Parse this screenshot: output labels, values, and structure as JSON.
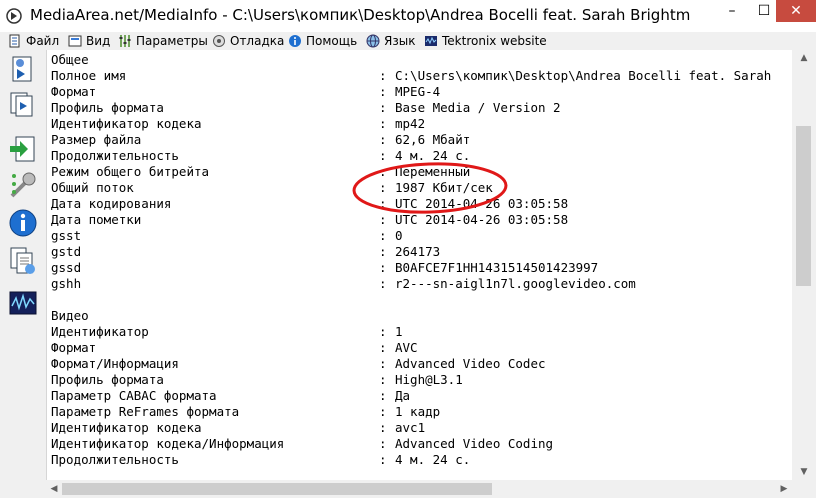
{
  "window": {
    "title": "MediaArea.net/MediaInfo - C:\\Users\\компик\\Desktop\\Andrea Bocelli feat. Sarah Brightman Canto de",
    "minimize": "–",
    "maximize": "☐",
    "close": "✕"
  },
  "menu": {
    "file": "Файл",
    "view": "Вид",
    "options": "Параметры",
    "debug": "Отладка",
    "help": "Помощь",
    "language": "Язык",
    "tektronix": "Tektronix website"
  },
  "icons": {
    "sidebar": [
      "open-file-icon",
      "open-folder-icon",
      "export-icon",
      "preferences-icon",
      "about-info-icon",
      "report-icon",
      "tektronix-icon"
    ],
    "annotation_color": "#e01818"
  },
  "content": {
    "general_header": "Общее",
    "general": [
      {
        "key": "Полное имя",
        "value": "C:\\Users\\компик\\Desktop\\Andrea Bocelli feat. Sarah"
      },
      {
        "key": "Формат",
        "value": "MPEG-4"
      },
      {
        "key": "Профиль формата",
        "value": "Base Media / Version 2"
      },
      {
        "key": "Идентификатор кодека",
        "value": "mp42"
      },
      {
        "key": "Размер файла",
        "value": "62,6 Мбайт"
      },
      {
        "key": "Продолжительность",
        "value": "4 м. 24 с."
      },
      {
        "key": "Режим общего битрейта",
        "value": "Переменный"
      },
      {
        "key": "Общий поток",
        "value": "1987 Кбит/сек"
      },
      {
        "key": "Дата кодирования",
        "value": "UTC 2014-04-26 03:05:58"
      },
      {
        "key": "Дата пометки",
        "value": "UTC 2014-04-26 03:05:58"
      },
      {
        "key": "gsst",
        "value": "0"
      },
      {
        "key": "gstd",
        "value": "264173"
      },
      {
        "key": "gssd",
        "value": "B0AFCE7F1HH1431514501423997"
      },
      {
        "key": "gshh",
        "value": "r2---sn-aigl1n7l.googlevideo.com"
      }
    ],
    "video_header": "Видео",
    "video": [
      {
        "key": "Идентификатор",
        "value": "1"
      },
      {
        "key": "Формат",
        "value": "AVC"
      },
      {
        "key": "Формат/Информация",
        "value": "Advanced Video Codec"
      },
      {
        "key": "Профиль формата",
        "value": "High@L3.1"
      },
      {
        "key": "Параметр CABAC формата",
        "value": "Да"
      },
      {
        "key": "Параметр ReFrames формата",
        "value": "1 кадр"
      },
      {
        "key": "Идентификатор кодека",
        "value": "avc1"
      },
      {
        "key": "Идентификатор кодека/Информация",
        "value": "Advanced Video Coding"
      },
      {
        "key": "Продолжительность",
        "value": "4 м. 24 с."
      }
    ],
    "separator": ":"
  }
}
